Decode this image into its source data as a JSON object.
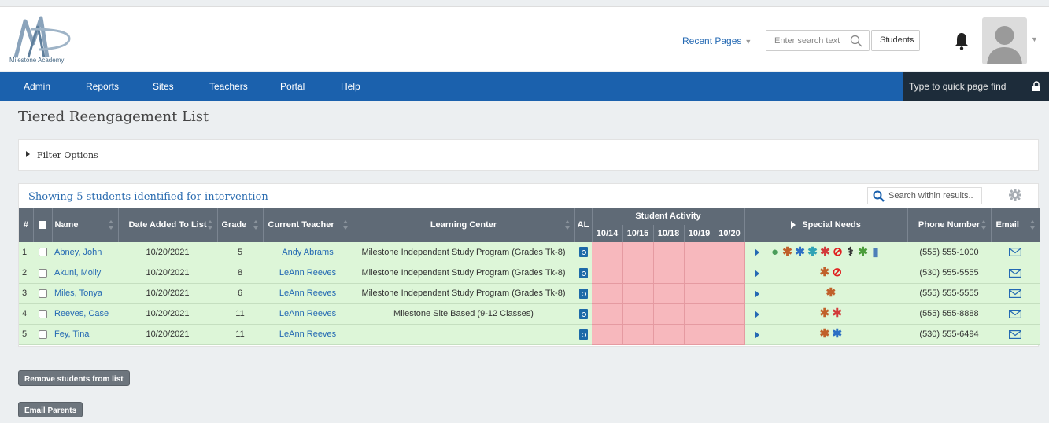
{
  "header": {
    "logo_text": "Milestone Academy",
    "recent_pages": "Recent Pages",
    "search": {
      "placeholder": "Enter search text"
    },
    "scope_select": "Students"
  },
  "nav": {
    "items": [
      "Admin",
      "Reports",
      "Sites",
      "Teachers",
      "Portal",
      "Help"
    ],
    "quick_find": "Type to quick page find"
  },
  "page": {
    "title": "Tiered Reengagement List",
    "filter_label": "Filter Options",
    "showing_text": "Showing  5  students identified for intervention",
    "results_search_placeholder": "Search within results.."
  },
  "table": {
    "headers": {
      "num": "#",
      "name": "Name",
      "date_added": "Date Added To List",
      "grade": "Grade",
      "teacher": "Current Teacher",
      "learning_center": "Learning Center",
      "al": "AL",
      "student_activity": "Student Activity",
      "special_needs": "Special Needs",
      "phone": "Phone Number",
      "email": "Email"
    },
    "activity_dates": [
      "10/14",
      "10/15",
      "10/18",
      "10/19",
      "10/20"
    ],
    "rows": [
      {
        "num": "1",
        "name": "Abney, John",
        "date": "10/20/2021",
        "grade": "5",
        "teacher": "Andy Abrams",
        "center": "Milestone Independent Study Program (Grades Tk-8)",
        "phone": "(555) 555-1000",
        "needs": [
          "globe",
          "puzzle-orange",
          "puzzle-blue",
          "puzzle-teal",
          "puzzle-red",
          "no-sign",
          "caduceus",
          "puzzle-green",
          "person-group"
        ]
      },
      {
        "num": "2",
        "name": "Akuni, Molly",
        "date": "10/20/2021",
        "grade": "8",
        "teacher": "LeAnn Reeves",
        "center": "Milestone Independent Study Program (Grades Tk-8)",
        "phone": "(530) 555-5555",
        "needs": [
          "puzzle-orange",
          "no-sign"
        ]
      },
      {
        "num": "3",
        "name": "Miles, Tonya",
        "date": "10/20/2021",
        "grade": "6",
        "teacher": "LeAnn Reeves",
        "center": "Milestone Independent Study Program (Grades Tk-8)",
        "phone": "(555) 555-5555",
        "needs": [
          "puzzle-orange"
        ]
      },
      {
        "num": "4",
        "name": "Reeves, Case",
        "date": "10/20/2021",
        "grade": "11",
        "teacher": "LeAnn Reeves",
        "center": "Milestone Site Based (9-12 Classes)",
        "phone": "(555) 555-8888",
        "needs": [
          "puzzle-orange",
          "puzzle-red"
        ]
      },
      {
        "num": "5",
        "name": "Fey, Tina",
        "date": "10/20/2021",
        "grade": "11",
        "teacher": "LeAnn Reeves",
        "center": "",
        "phone": "(530) 555-6494",
        "needs": [
          "puzzle-orange",
          "puzzle-blue"
        ]
      }
    ]
  },
  "buttons": {
    "remove": "Remove students from list",
    "email_parents": "Email Parents"
  },
  "colors": {
    "nav_blue": "#1b61ad",
    "row_green": "#ddf6d8",
    "activity_pink": "#f7b8bd",
    "header_gray": "#5f6a76"
  }
}
